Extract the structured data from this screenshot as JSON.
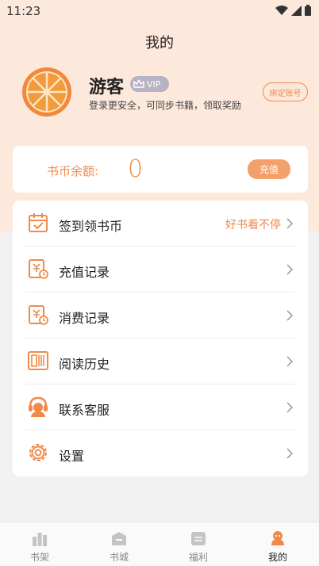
{
  "status_bar": {
    "time": "11:23"
  },
  "page_title": "我的",
  "profile": {
    "username": "游客",
    "vip_label": "VIP",
    "hint": "登录更安全，可同步书籍，领取奖励",
    "bind_label": "绑定账号"
  },
  "coins": {
    "label": "书币余额:",
    "value": "0",
    "recharge_label": "充值"
  },
  "menu": [
    {
      "label": "签到领书币",
      "extra": "好书看不停",
      "icon": "calendar-check-icon"
    },
    {
      "label": "充值记录",
      "extra": "",
      "icon": "recharge-record-icon"
    },
    {
      "label": "消费记录",
      "extra": "",
      "icon": "consume-record-icon"
    },
    {
      "label": "阅读历史",
      "extra": "",
      "icon": "reading-history-icon"
    },
    {
      "label": "联系客服",
      "extra": "",
      "icon": "customer-service-icon"
    },
    {
      "label": "设置",
      "extra": "",
      "icon": "settings-icon"
    }
  ],
  "bottom_nav": [
    {
      "label": "书架",
      "icon": "bookshelf-icon",
      "active": false
    },
    {
      "label": "书城",
      "icon": "bookstore-icon",
      "active": false
    },
    {
      "label": "福利",
      "icon": "welfare-icon",
      "active": false
    },
    {
      "label": "我的",
      "icon": "profile-icon",
      "active": true
    }
  ],
  "colors": {
    "accent": "#f08a4b",
    "hero_bg": "#fde8dc",
    "page_bg": "#f1f1f1",
    "vip_badge": "#b7b3c4"
  }
}
